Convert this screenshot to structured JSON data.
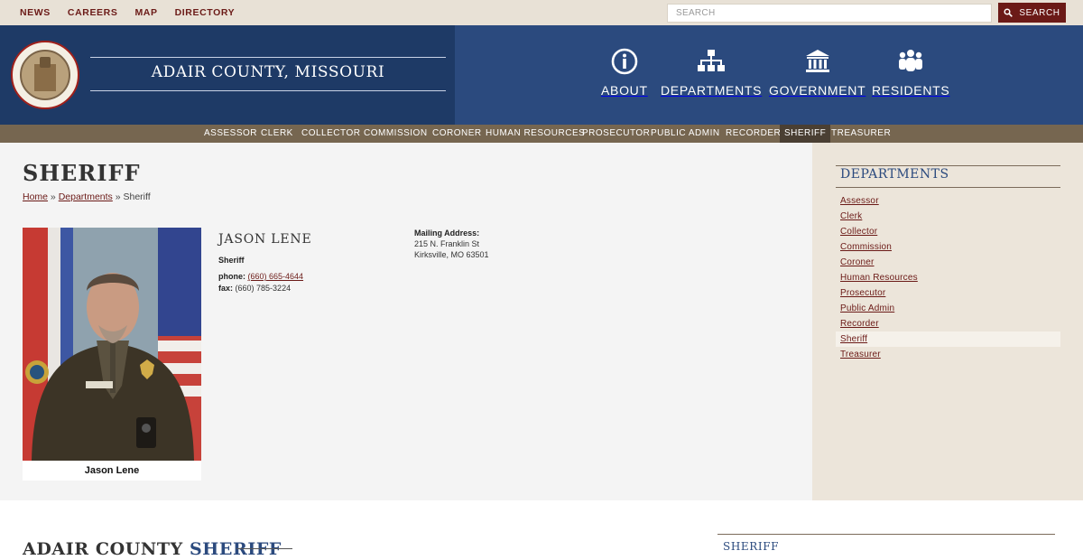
{
  "utility_nav": {
    "items": [
      "NEWS",
      "CAREERS",
      "MAP",
      "DIRECTORY"
    ]
  },
  "search": {
    "placeholder": "SEARCH",
    "button_label": "SEARCH"
  },
  "header": {
    "title": "ADAIR COUNTY, MISSOURI",
    "main_nav": [
      "ABOUT",
      "DEPARTMENTS",
      "GOVERNMENT",
      "RESIDENTS"
    ]
  },
  "dept_strip": {
    "items": [
      "ASSESSOR",
      "CLERK",
      "COLLECTOR",
      "COMMISSION",
      "CORONER",
      "HUMAN RESOURCES",
      "PROSECUTOR",
      "PUBLIC ADMIN",
      "RECORDER",
      "SHERIFF",
      "TREASURER"
    ],
    "active": "SHERIFF"
  },
  "page": {
    "title": "SHERIFF",
    "breadcrumb": {
      "home": "Home",
      "sep1": " » ",
      "departments": "Departments",
      "sep2": " » ",
      "current": "Sheriff"
    }
  },
  "profile": {
    "photo_caption": "Jason Lene",
    "name": "JASON LENE",
    "role": "Sheriff",
    "phone_label": "phone:",
    "phone": "(660) 665-4644",
    "fax_label": "fax:",
    "fax": "(660) 785-3224",
    "mailing_label": "Mailing Address:",
    "address_line1": "215 N. Franklin St",
    "address_line2": "Kirksville, MO 63501"
  },
  "sidebar": {
    "title": "DEPARTMENTS",
    "items": [
      "Assessor",
      "Clerk",
      "Collector",
      "Commission",
      "Coroner",
      "Human Resources",
      "Prosecutor",
      "Public Admin",
      "Recorder",
      "Sheriff",
      "Treasurer"
    ],
    "active": "Sheriff"
  },
  "lower": {
    "title_plain": "ADAIR COUNTY ",
    "title_accent": "SHERIFF",
    "side_title": "SHERIFF"
  },
  "colors": {
    "maroon": "#6b1a17",
    "navy": "#1e3a66",
    "blue": "#2b4a7e",
    "strip": "#766650"
  }
}
